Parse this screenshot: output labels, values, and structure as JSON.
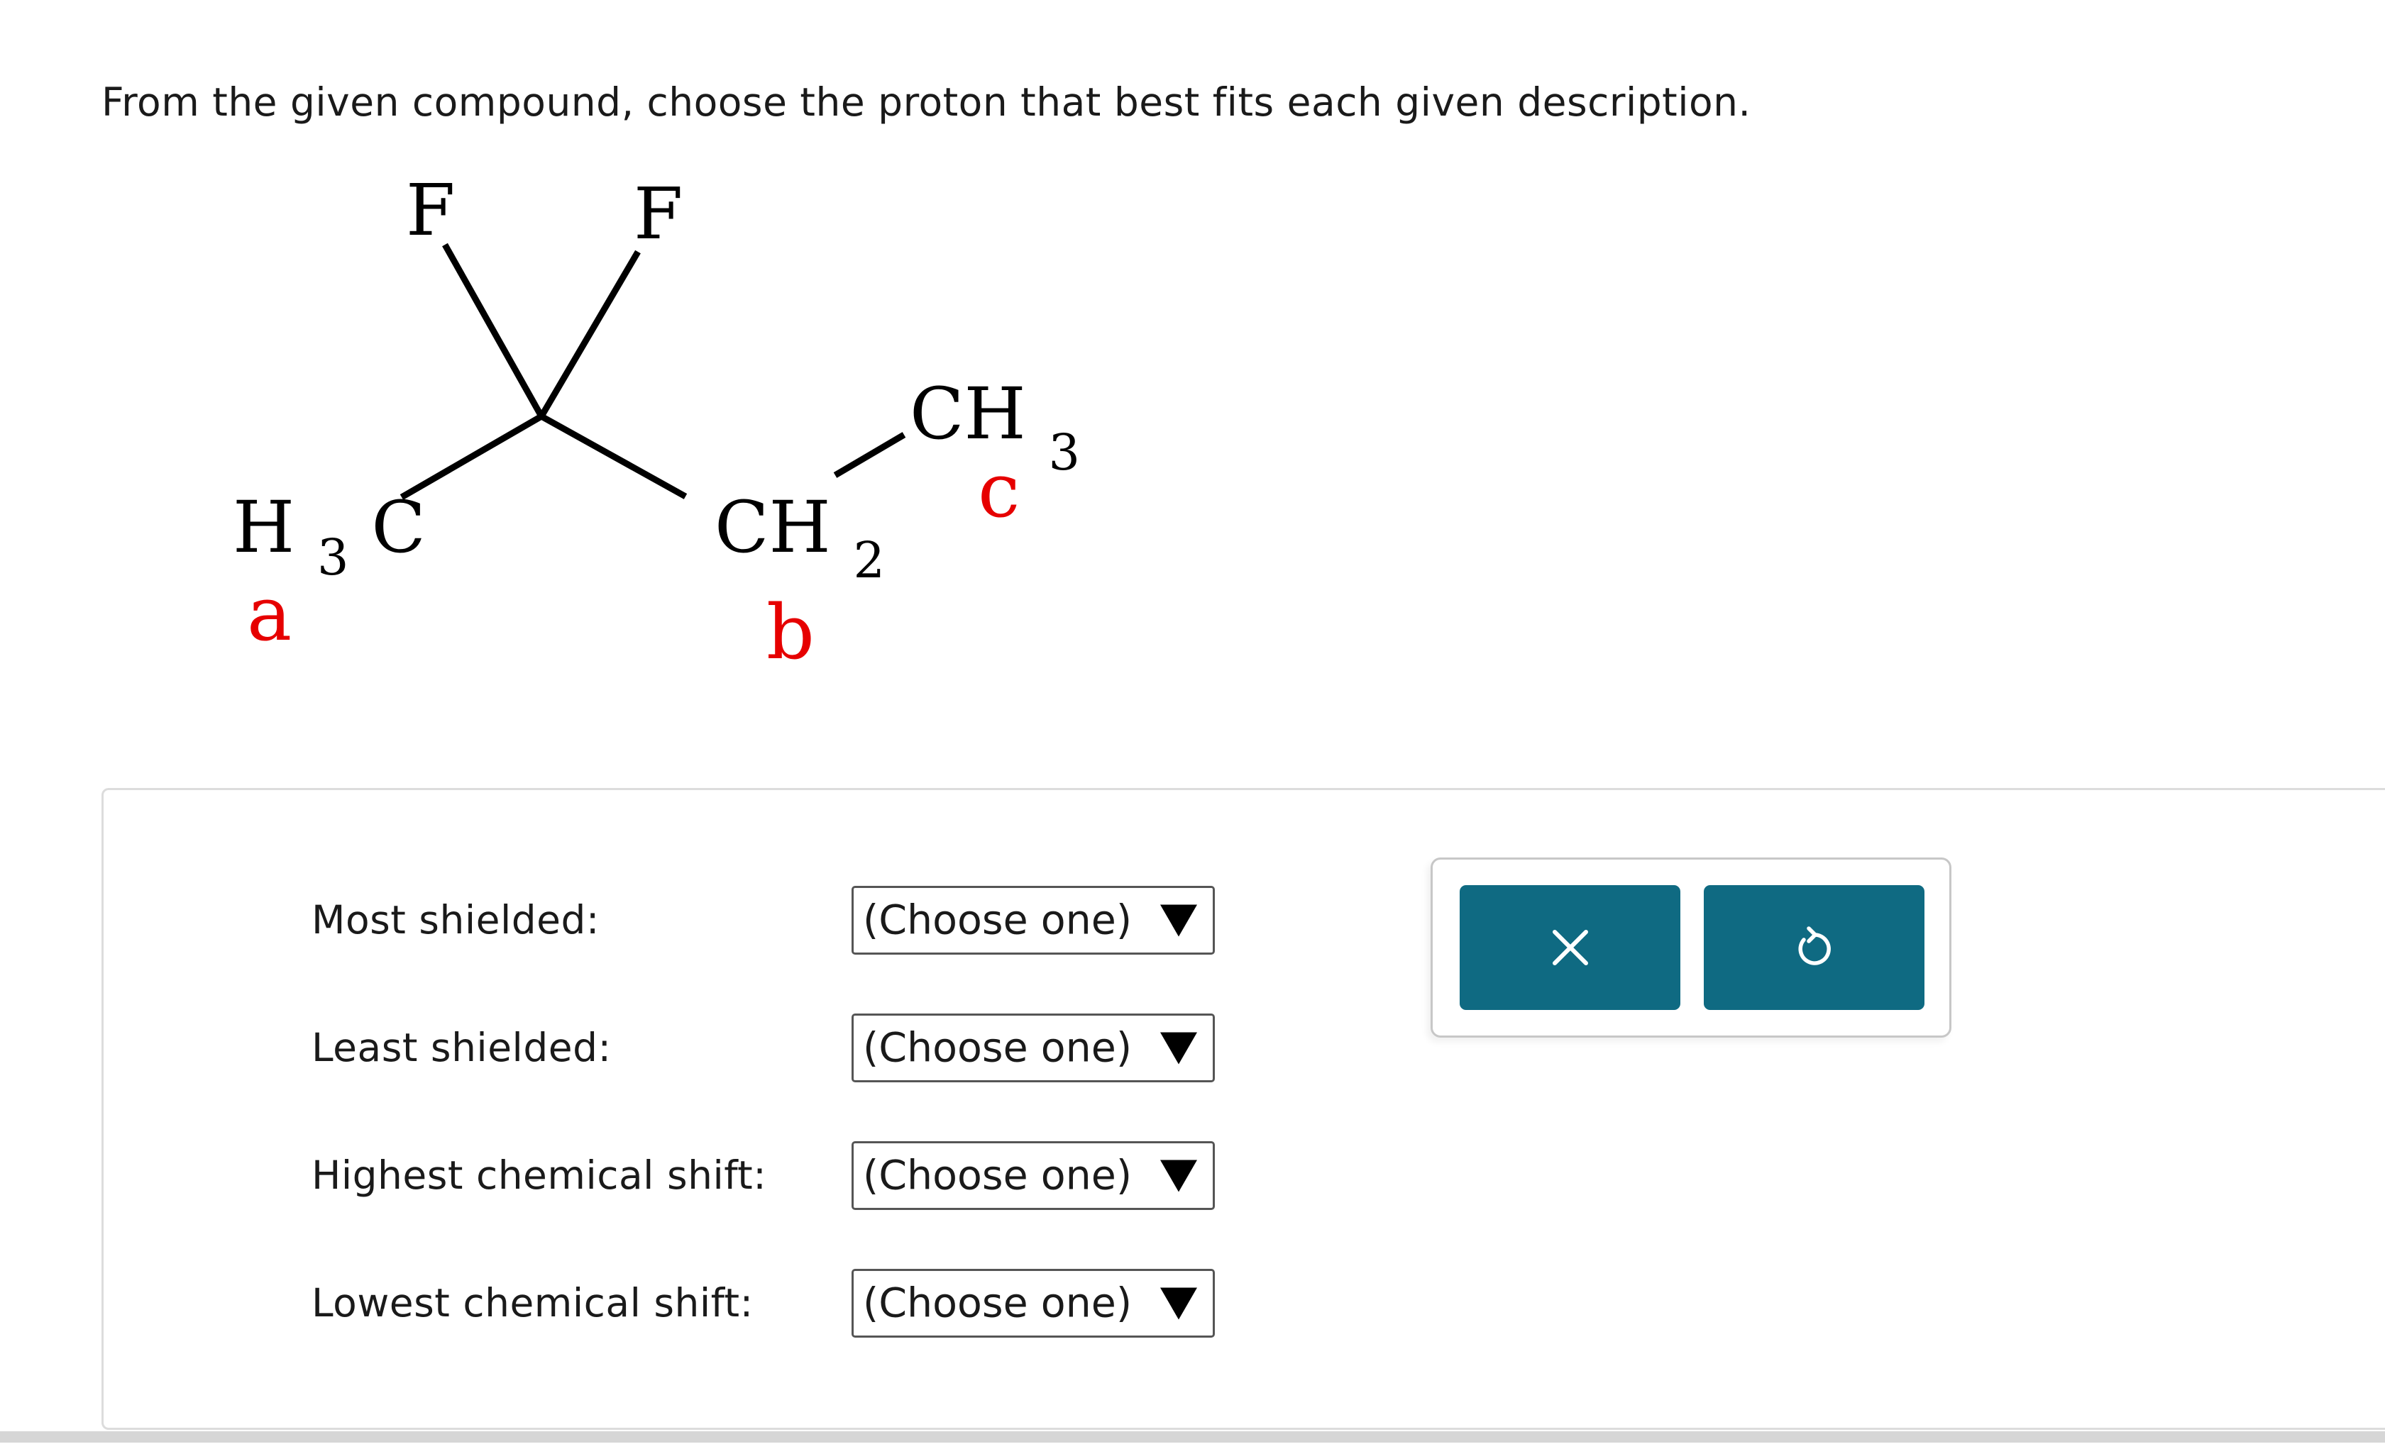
{
  "question": {
    "text": "From the given compound, choose the proton that best fits each given description."
  },
  "molecule": {
    "fluorine_left": "F",
    "fluorine_right": "F",
    "group_a": {
      "h": "H",
      "sub": "3",
      "c": "C",
      "label": "a"
    },
    "group_b": {
      "formula": "CH",
      "sub": "2",
      "label": "b"
    },
    "group_c": {
      "formula": "CH",
      "sub": "3",
      "label": "c"
    },
    "label_color": "#e60000"
  },
  "rows": [
    {
      "label": "Most shielded:",
      "value": "(Choose one)"
    },
    {
      "label": "Least shielded:",
      "value": "(Choose one)"
    },
    {
      "label": "Highest chemical shift:",
      "value": "(Choose one)"
    },
    {
      "label": "Lowest chemical shift:",
      "value": "(Choose one)"
    }
  ],
  "tools": {
    "clear_icon": "close-icon",
    "undo_icon": "undo-icon",
    "button_color": "#0f6a82"
  }
}
